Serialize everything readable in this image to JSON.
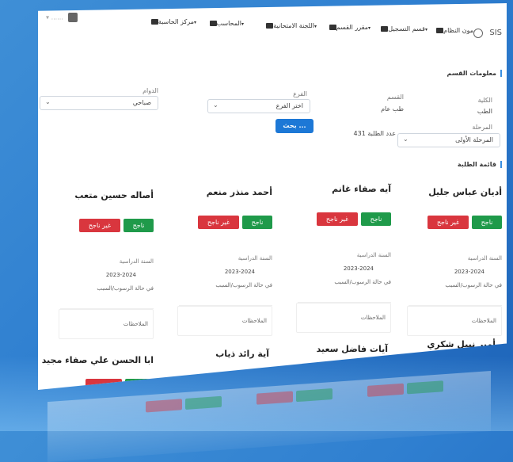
{
  "brand": {
    "name": "SIS",
    "corner_text": "......"
  },
  "nav": [
    {
      "label": "مركز الحاسبة"
    },
    {
      "label": "المحاسب"
    },
    {
      "label": "اللجنة الامتحانية"
    },
    {
      "label": "مقرر القسم"
    },
    {
      "label": "قسم التسجيل"
    },
    {
      "label": "مون النظام"
    }
  ],
  "dept_info": {
    "title": "معلومات القسم",
    "college_label": "الكلية",
    "college_value": "الطب",
    "dept_label": "القسم",
    "dept_value": "طب عام",
    "branch_label": "الفرع",
    "branch_placeholder": "اختر الفرع",
    "shift_label": "الدوام",
    "shift_value": "صباحي",
    "stage_label": "المرحلة",
    "stage_value": "المرحلة الأولى",
    "count_text": "عدد الطلبة 431",
    "search_label": "بحث ..."
  },
  "students_title": "قائمة الطلبة",
  "card_labels": {
    "pass": "ناجح",
    "fail": "غير ناجح",
    "year_label": "السنة الدراسية",
    "year_value": "2023-2024",
    "status_label": "في حالة الرسوب/السبب",
    "notes_label": "الملاحظات"
  },
  "students_row1": [
    {
      "name": "أديان عباس جليل"
    },
    {
      "name": "آيه صفاء غانم"
    },
    {
      "name": "أحمد منذر منعم"
    },
    {
      "name": "أصاله حسين متعب"
    }
  ],
  "students_row2": [
    {
      "name": "أمير نبيل شكري"
    },
    {
      "name": "آيات فاضل سعيد"
    },
    {
      "name": "آية رائد ذياب"
    },
    {
      "name": "ابا الحسن علي صفاء مجيد"
    }
  ],
  "colors": {
    "pass": "#1f9a4a",
    "fail": "#d9363e",
    "primary": "#1d78d6",
    "accent": "#3b8fe0"
  }
}
